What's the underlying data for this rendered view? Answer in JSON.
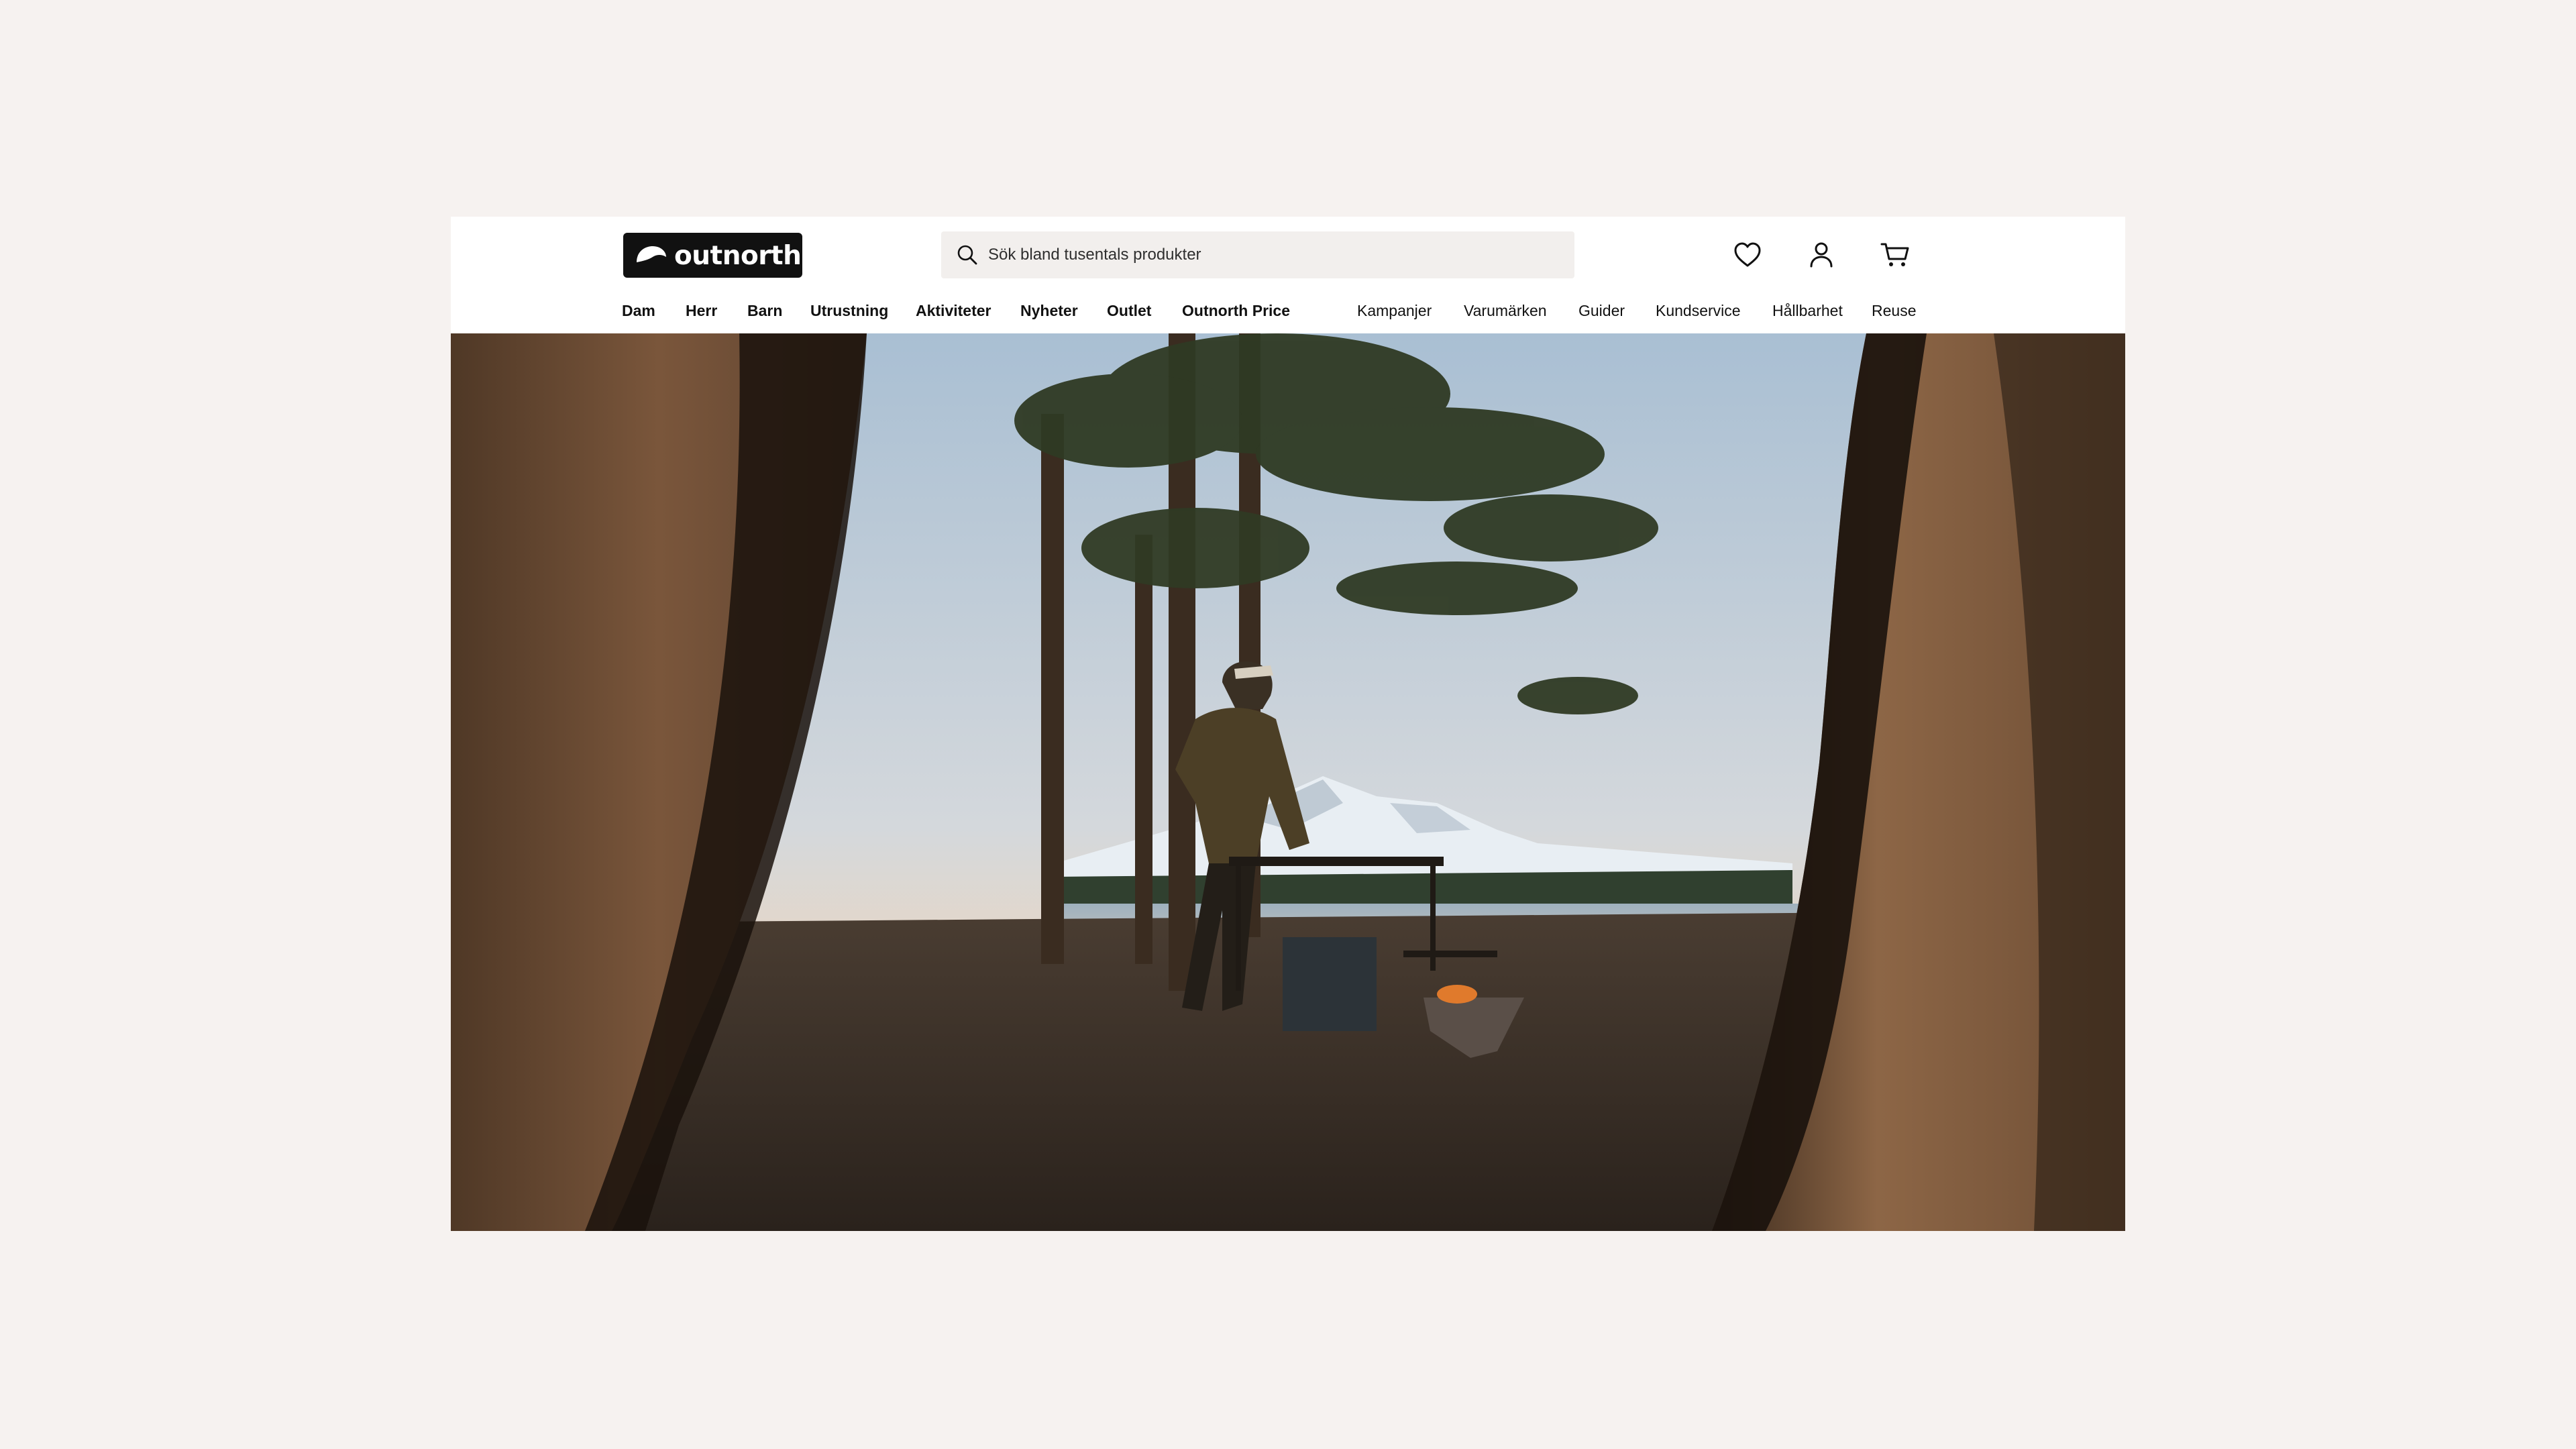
{
  "brand": {
    "name": "outnorth",
    "color": "#111111"
  },
  "search": {
    "placeholder": "Sök bland tusentals produkter",
    "icon": "search-icon"
  },
  "header_icons": [
    {
      "name": "heart-icon",
      "label": "Favoriter"
    },
    {
      "name": "user-icon",
      "label": "Konto"
    },
    {
      "name": "cart-icon",
      "label": "Varukorg"
    }
  ],
  "nav": {
    "primary": [
      "Dam",
      "Herr",
      "Barn",
      "Utrustning",
      "Aktiviteter",
      "Nyheter",
      "Outlet",
      "Outnorth Price"
    ],
    "secondary": [
      "Kampanjer",
      "Varumärken",
      "Guider",
      "Kundservice",
      "Hållbarhet",
      "Reuse"
    ]
  },
  "hero": {
    "image": "camp-scene-tent-view",
    "colors": {
      "sky_top": "#a9bfd3",
      "sky_horizon": "#f3d6b8",
      "tent": "#6b4a33",
      "ground": "#3a3028"
    }
  },
  "colors": {
    "page_background": "#f6f2f0",
    "header_background": "#ffffff",
    "search_background": "#f2efed",
    "text": "#111111"
  }
}
